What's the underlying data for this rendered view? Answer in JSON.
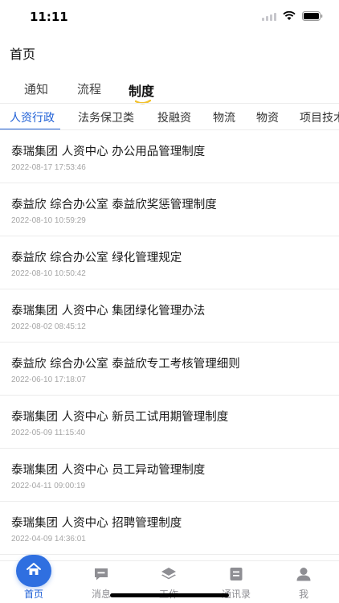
{
  "status": {
    "time": "11:11"
  },
  "header": {
    "title": "首页"
  },
  "top_tabs": [
    {
      "label": "通知"
    },
    {
      "label": "流程"
    },
    {
      "label": "制度"
    }
  ],
  "top_tabs_active": "制度",
  "sub_tabs": [
    {
      "label": "人资行政"
    },
    {
      "label": "法务保卫类"
    },
    {
      "label": "投融资"
    },
    {
      "label": "物流"
    },
    {
      "label": "物资"
    },
    {
      "label": "项目技术"
    }
  ],
  "sub_tabs_active": "人资行政",
  "items": [
    {
      "title": "泰瑞集团 人资中心 办公用品管理制度",
      "time": "2022-08-17 17:53:46"
    },
    {
      "title": "泰益欣 综合办公室 泰益欣奖惩管理制度",
      "time": "2022-08-10 10:59:29"
    },
    {
      "title": "泰益欣 综合办公室 绿化管理规定",
      "time": "2022-08-10 10:50:42"
    },
    {
      "title": "泰瑞集团 人资中心 集团绿化管理办法",
      "time": "2022-08-02 08:45:12"
    },
    {
      "title": "泰益欣 综合办公室 泰益欣专工考核管理细则",
      "time": "2022-06-10 17:18:07"
    },
    {
      "title": "泰瑞集团 人资中心 新员工试用期管理制度",
      "time": "2022-05-09 11:15:40"
    },
    {
      "title": "泰瑞集团 人资中心 员工异动管理制度",
      "time": "2022-04-11 09:00:19"
    },
    {
      "title": "泰瑞集团 人资中心 招聘管理制度",
      "time": "2022-04-09 14:36:01"
    }
  ],
  "tab_bar": [
    {
      "label": "首页",
      "icon": "home-icon"
    },
    {
      "label": "消息",
      "icon": "message-icon"
    },
    {
      "label": "工作",
      "icon": "layers-icon"
    },
    {
      "label": "通讯录",
      "icon": "contacts-icon"
    },
    {
      "label": "我",
      "icon": "person-icon"
    }
  ],
  "colors": {
    "accent": "#1e5fd6",
    "home_bubble": "#2f6fe0",
    "tab_underline": "#f2c230"
  }
}
